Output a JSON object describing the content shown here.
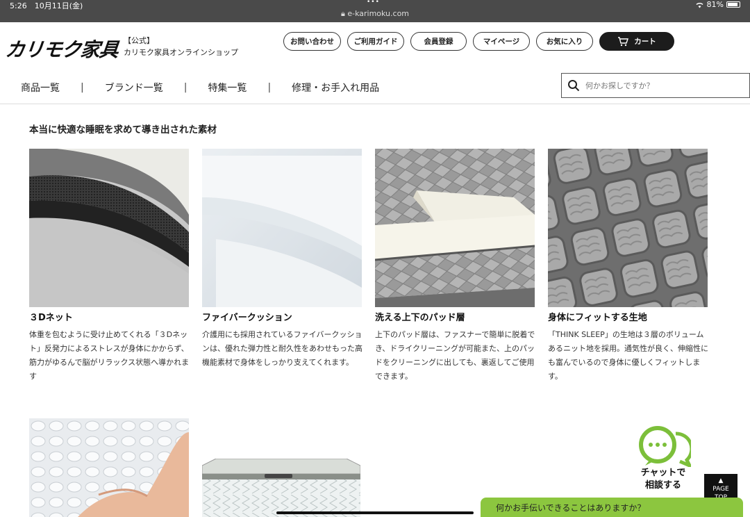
{
  "status": {
    "time": "5:26",
    "date": "10月11日(金)",
    "url": "e-karimoku.com",
    "battery": "81%"
  },
  "header": {
    "logo": "カリモク家具",
    "official_tag": "【公式】",
    "official_name": "カリモク家具オンラインショップ",
    "buttons": [
      "お問い合わせ",
      "ご利用ガイド",
      "会員登録",
      "マイページ",
      "お気に入り"
    ],
    "cart_label": "カート"
  },
  "nav": {
    "items": [
      "商品一覧",
      "ブランド一覧",
      "特集一覧",
      "修理・お手入れ用品"
    ],
    "separator": "|"
  },
  "search": {
    "placeholder": "何かお探しですか？"
  },
  "section": {
    "title": "本当に快適な睡眠を求めて導き出された素材",
    "cards": [
      {
        "name": "３Dネット",
        "desc": "体重を包むように受け止めてくれる「３Dネット」反発力によるストレスが身体にかからず、筋力がゆるんで脳がリラックス状態へ導かれます"
      },
      {
        "name": "ファイバークッション",
        "desc": "介護用にも採用されているファイバークッションは、優れた弾力性と耐久性をあわせもった高機能素材で身体をしっかり支えてくれます。"
      },
      {
        "name": "洗える上下のパッド層",
        "desc": "上下のパッド層は、ファスナーで簡単に脱着でき、ドライクリーニングが可能また、上のパッドをクリーニングに出しても、裏返してご使用できます。"
      },
      {
        "name": "身体にフィットする生地",
        "desc": "「THINK SLEEP」の生地は３層のボリュームあるニット地を採用。通気性が良く、伸縮性にも富んでいるので身体に優しくフィットします。"
      }
    ]
  },
  "chat": {
    "label_line1": "チャットで",
    "label_line2": "相談する",
    "bar_text": "何かお手伝いできることはありますか？"
  },
  "pagetop": {
    "arrow": "▲",
    "line1": "PAGE",
    "line2": "TOP"
  }
}
